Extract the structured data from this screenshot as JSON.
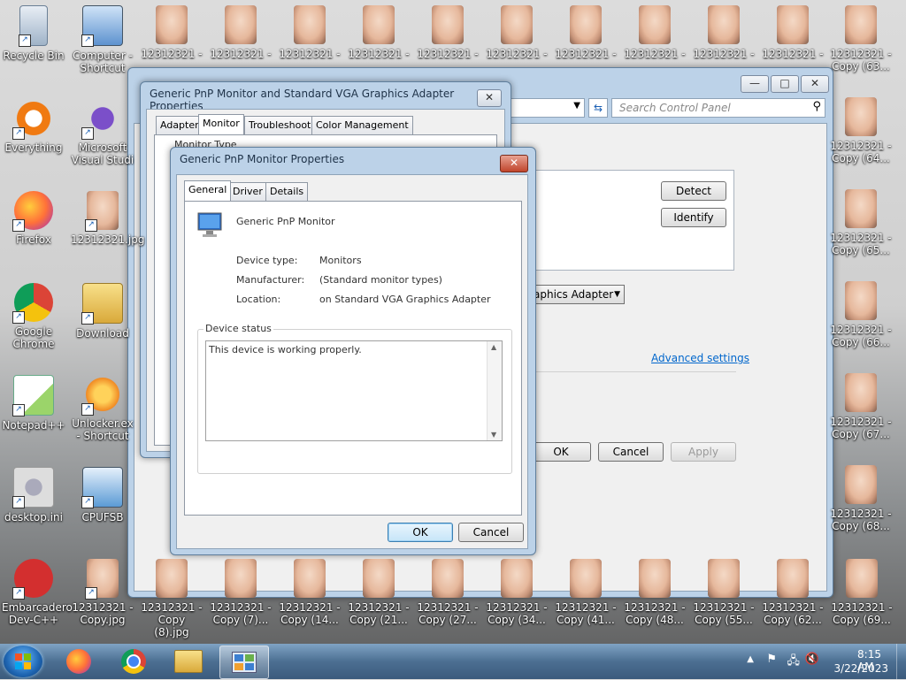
{
  "desktop": {
    "left_icons": [
      {
        "label": "Recycle Bin",
        "icon": "recycle-bin-icon"
      },
      {
        "label": "Everything",
        "icon": "everything-search-icon"
      },
      {
        "label": "Firefox",
        "icon": "firefox-icon"
      },
      {
        "label": "Google Chrome",
        "icon": "chrome-icon"
      },
      {
        "label": "Notepad++",
        "icon": "notepadpp-icon"
      },
      {
        "label": "desktop.ini",
        "icon": "settings-file-icon"
      },
      {
        "label": "Embarcadero Dev-C++",
        "icon": "devcpp-icon"
      }
    ],
    "col2_icons": [
      {
        "label": "Computer - Shortcut",
        "icon": "computer-icon"
      },
      {
        "label": "Microsoft Visual Studi",
        "icon": "visual-studio-icon"
      },
      {
        "label": "12312321.jpg",
        "icon": "photo-icon"
      },
      {
        "label": "Download",
        "icon": "folder-icon"
      },
      {
        "label": "Unlocker.ex - Shortcut",
        "icon": "unlocker-icon"
      },
      {
        "label": "CPUFSB",
        "icon": "app-icon"
      },
      {
        "label": "12312321 - Copy.jpg",
        "icon": "photo-icon"
      }
    ],
    "top_row_label": "12312321 -",
    "bottom_row": [
      "12312321 - Copy (8).jpg",
      "12312321 - Copy (7)...",
      "12312321 - Copy (14...",
      "12312321 - Copy (21...",
      "12312321 - Copy (27...",
      "12312321 - Copy (34...",
      "12312321 - Copy (41...",
      "12312321 - Copy (48...",
      "12312321 - Copy (55...",
      "12312321 - Copy (62...",
      "12312321 - Copy (69..."
    ],
    "right_col": [
      "12312321 - Copy (63...",
      "12312321 - Copy (64...",
      "12312321 - Copy (65...",
      "12312321 - Copy (66...",
      "12312321 - Copy (67...",
      "12312321 - Copy (68..."
    ]
  },
  "control_panel": {
    "search_placeholder": "Search Control Panel",
    "detect": "Detect",
    "identify": "Identify",
    "adapter_dropdown": "aphics Adapter",
    "advanced_link": "Advanced settings",
    "ok": "OK",
    "cancel": "Cancel",
    "apply": "Apply",
    "minimize": "—",
    "maximize": "□",
    "close": "✕"
  },
  "adapter_dialog": {
    "title": "Generic PnP Monitor and Standard VGA Graphics Adapter Properties",
    "tabs": [
      "Adapter",
      "Monitor",
      "Troubleshoot",
      "Color Management"
    ],
    "monitor_type_label": "Monitor Type",
    "close": "✕"
  },
  "monitor_dialog": {
    "title": "Generic PnP Monitor Properties",
    "tabs": [
      "General",
      "Driver",
      "Details"
    ],
    "device_name": "Generic PnP Monitor",
    "device_type_label": "Device type:",
    "device_type": "Monitors",
    "manufacturer_label": "Manufacturer:",
    "manufacturer": "(Standard monitor types)",
    "location_label": "Location:",
    "location": "on Standard VGA Graphics Adapter",
    "status_group": "Device status",
    "status_text": "This device is working properly.",
    "ok": "OK",
    "cancel": "Cancel",
    "close": "✕"
  },
  "taskbar": {
    "time": "8:15 AM",
    "date": "3/22/2023"
  }
}
